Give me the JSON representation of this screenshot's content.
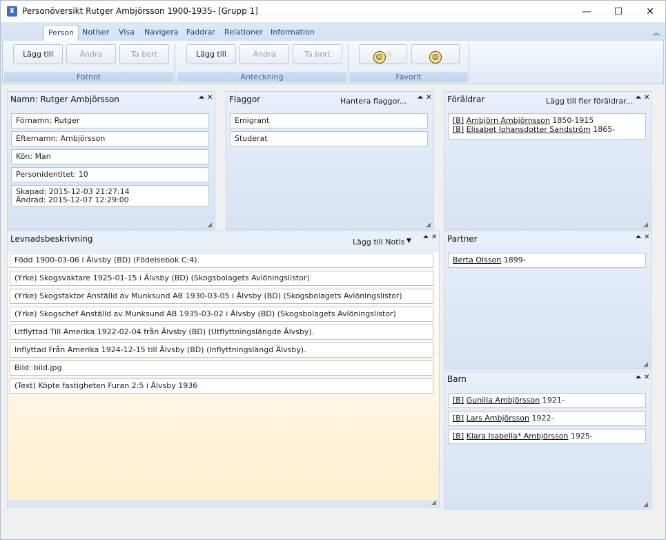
{
  "window": {
    "title": "Personöversikt Rutger Ambjörsson 1900-1935- [Grupp 1]",
    "minimize": "—",
    "maximize": "☐",
    "close": "✕"
  },
  "tabs": [
    {
      "label": "Person"
    },
    {
      "label": "Notiser"
    },
    {
      "label": "Visa"
    },
    {
      "label": "Navigera"
    },
    {
      "label": "Faddrar"
    },
    {
      "label": "Relationer"
    },
    {
      "label": "Information"
    }
  ],
  "ribbon": {
    "groups": [
      {
        "label": "Fotnot",
        "buttons": [
          "Lägg till",
          "Ändra",
          "Ta bort"
        ]
      },
      {
        "label": "Anteckning",
        "buttons": [
          "Lägg till",
          "Ändra",
          "Ta bort"
        ]
      },
      {
        "label": "Favorit"
      }
    ]
  },
  "panels": {
    "namn": {
      "title": "Namn: Rutger Ambjörsson",
      "fields": [
        "Förnamn: Rutger",
        "Efternamn: Ambjörsson",
        "Kön: Man",
        "Personidentitet: 10"
      ],
      "created": "Skapad: 2015-12-03 21:27:14",
      "changed": "Ändrad: 2015-12-07 12:29:00"
    },
    "flaggor": {
      "title": "Flaggor",
      "action": "Hantera flaggor...",
      "items": [
        "Emigrant",
        "Studerat"
      ]
    },
    "foraldrar": {
      "title": "Föräldrar",
      "action": "Lägg till fler föräldrar...",
      "items": [
        {
          "tag": "[B]",
          "name": "Ambjörn Ambjörnsson",
          "years": "1850-1915"
        },
        {
          "tag": "[B]",
          "name": "Elisabet Johansdotter Sandström",
          "years": "1865-"
        }
      ]
    },
    "levnad": {
      "title": "Levnadsbeskrivning",
      "action": "Lägg till Notis",
      "items": [
        "Född 1900-03-06 i Älvsby (BD) (Födelsebok C:4).",
        "(Yrke) Skogsvaktare 1925-01-15 i Älvsby (BD) (Skogsbolagets Avlöningslistor)",
        "(Yrke) Skogsfaktor Anställd av Munksund AB 1930-03-05 i Älvsby (BD) (Skogsbolagets Avlöningslistor)",
        "(Yrke) Skogschef Anställd av Munksund AB 1935-03-02 i Älvsby (BD) (Skogsbolagets Avlöningslistor)",
        "Utflyttad Till Amerika 1922-02-04 från Älvsby (BD) (Utflyttningslängde Älvsby).",
        "Inflyttad Från Amerika 1924-12-15 till Älvsby (BD) (Inflyttningslängd Älvsby).",
        "Bild: bild.jpg",
        "(Text) Köpte fastigheten Furan 2:5 i Älvsby 1936"
      ]
    },
    "partner": {
      "title": "Partner",
      "items": [
        {
          "name": "Berta Olsson",
          "years": "1899-"
        }
      ]
    },
    "barn": {
      "title": "Barn",
      "items": [
        {
          "tag": "[B]",
          "name": "Gunilla Ambjörsson",
          "years": "1921-"
        },
        {
          "tag": "[B]",
          "name": "Lars Ambjörsson",
          "years": "1922-"
        },
        {
          "tag": "[B]",
          "name": "Klara Isabella* Ambjörsson",
          "years": "1925-"
        }
      ]
    }
  }
}
